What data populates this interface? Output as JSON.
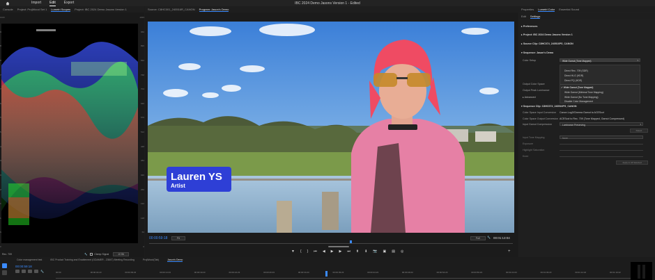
{
  "app": {
    "window_title": "IBC 2024 Demo Jasons Version 1 - Edited",
    "nav": [
      "Import",
      "Edit",
      "Export"
    ],
    "active_nav": "Edit"
  },
  "scope_panel": {
    "tabs": [
      "Console",
      "Project: ProjWood Set 1",
      "Lumetri Scopes",
      "Project: IBC 2024 Demo Jasons Version 1"
    ],
    "active_tab": "Lumetri Scopes",
    "left_ticks": [
      "1023",
      "960",
      "896",
      "832",
      "768",
      "704",
      "640",
      "576",
      "512",
      "448",
      "384",
      "320",
      "256",
      "192",
      "128",
      "64",
      "0"
    ],
    "right_ticks": [
      "1023",
      "960",
      "896",
      "832",
      "768",
      "704",
      "640",
      "576",
      "512",
      "448",
      "384",
      "320",
      "256",
      "192",
      "128",
      "64",
      "0"
    ],
    "bottom_left": "Rec. 709",
    "clamp_label": "Clamp Signal",
    "bit_value": "10 Bit"
  },
  "viewer": {
    "source_tab": "Source: C8HC001_240516R_CANON",
    "program_tab": "Program: Jason's Demo",
    "lower_third_name": "Lauren YS",
    "lower_third_title": "Artist",
    "timecode_current": "00:00:59:18",
    "timecode_total": "00:01:13:04",
    "zoom": "Fit",
    "quality": "Full"
  },
  "props_panel": {
    "tabs": [
      "Properties",
      "Lumetri Color",
      "Essential Sound"
    ],
    "active_tab": "Lumetri Color",
    "subtabs": [
      "Edit",
      "Settings"
    ],
    "active_subtab": "Settings",
    "preferences": "Preferences",
    "project_line": "Project: IBC 2024 Demo Jasons Version 1",
    "source_clip_line": "Source Clip: C8HC074_240516PS_CANON",
    "sequence_line": "Sequence: Jason's Demo",
    "color_setup_label": "Color Setup",
    "color_setup_value": "Wide Gamut (Tone Mapped)",
    "output_color_space": "Output Color Space",
    "output_peak_luminance": "Output Peak Luminance",
    "advanced": "Advanced",
    "dropdown_options": [
      "Direct Rec. 709 (SDR)",
      "Direct HLG (HDR)",
      "Direct PQ (HDR)",
      "Wide Gamut (Tone Mapped)",
      "Wide Gamut (Minimal Tone Mapping)",
      "Wide Gamut (No Tone Mapping)",
      "Disable Color Management"
    ],
    "selected_option": "Wide Gamut (Tone Mapped)",
    "sequence_clip_line": "Sequence Clip: C8HC074_240516PS_CANON",
    "input_conversion_label": "Color Space Input Conversion",
    "input_conversion_value": "Canon Log3/Cinema Gamut to ACEScct",
    "output_conversion_label": "Color Space Output Conversion",
    "output_conversion_value": "ACEScct to Rec. 709 (Tone Mapped, Gamut Compressed)",
    "gamut_compression_label": "Input Gamut Compression",
    "gamut_compression_value": "Luminance Preserving",
    "detect_button": "Detect",
    "input_tone_mapping": "Input Tone Mapping",
    "input_tone_mapping_value": "None",
    "exposure": "Exposure",
    "highlight_saturation": "Highlight Saturation",
    "knee": "Knee",
    "apply_button": "Apply to All Selected"
  },
  "timeline": {
    "tabs": [
      "Color management test",
      "IBC Product Training and Enablement (GDAMER - 23847) Meeting Recording",
      "ProjWood(Tab)",
      "Jason's Demo"
    ],
    "active_tab": "Jason's Demo",
    "timecode": "00:00:59:18",
    "ruler_labels": [
      "00:00",
      "00:00:04:23",
      "00:00:09:23",
      "00:00:14:23",
      "00:00:19:23",
      "00:00:24:23",
      "00:00:29:23",
      "00:00:34:23",
      "00:00:39:23",
      "00:00:44:23",
      "00:00:49:23",
      "00:00:54:23",
      "00:00:59:23",
      "00:01:04:23",
      "00:01:09:23",
      "00:01:14:22",
      "00:01:19:22"
    ]
  },
  "colors": {
    "accent": "#3b8bff",
    "lower_third_bg": "#2e3fd6",
    "hair": "#e8475c",
    "jacket": "#e57fa0"
  }
}
